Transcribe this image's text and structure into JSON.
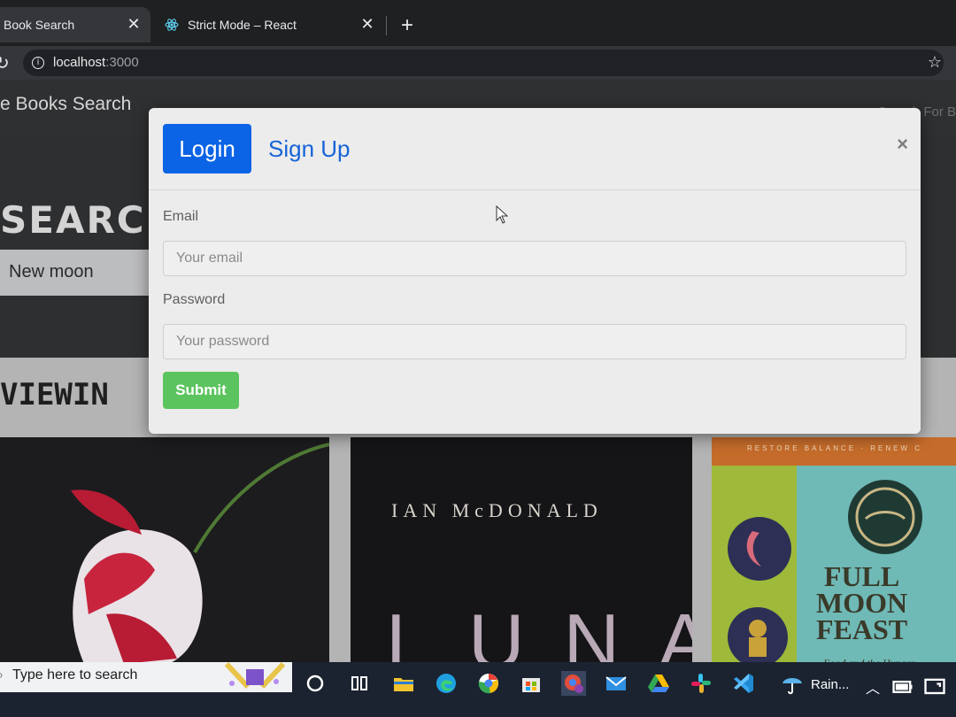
{
  "browser": {
    "tabs": [
      {
        "title": "Book Search",
        "active": true,
        "icon": "book-search-favicon"
      },
      {
        "title": "Strict Mode – React",
        "active": false,
        "icon": "react-favicon"
      }
    ],
    "close_glyph": "✕",
    "new_tab_glyph": "+",
    "url_host": "localhost",
    "url_port": ":3000"
  },
  "page": {
    "brand": "e Books Search",
    "nav_right": "Search For B",
    "hero_heading": "SEARC",
    "search_value": "New moon",
    "results_heading": "VIEWIN"
  },
  "books": [
    {
      "icon": "tulip-cover-art"
    },
    {
      "author": "IAN McDONALD",
      "title": "LUNA"
    },
    {
      "topline": "RESTORE BALANCE · RENEW C",
      "title_lines": [
        "FULL",
        "MOON",
        "FEAST"
      ],
      "subtitle": "Food and the Hunger"
    }
  ],
  "modal": {
    "tabs": {
      "login": "Login",
      "signup": "Sign Up"
    },
    "close_glyph": "×",
    "email_label": "Email",
    "email_placeholder": "Your email",
    "password_label": "Password",
    "password_placeholder": "Your password",
    "submit_label": "Submit"
  },
  "taskbar": {
    "search_placeholder": "Type here to search",
    "weather_label": "Rain...",
    "apps": [
      "cortana-icon",
      "task-view-icon",
      "file-explorer-icon",
      "edge-icon",
      "chrome-icon",
      "store-icon",
      "chrome-profile-icon",
      "mail-icon",
      "google-drive-icon",
      "slack-icon",
      "vscode-icon"
    ]
  },
  "colors": {
    "primary": "#0b63e5",
    "link": "#1764d8",
    "success": "#5cc45e",
    "modal_bg": "#ececec",
    "taskbar_bg": "#1b2330"
  }
}
